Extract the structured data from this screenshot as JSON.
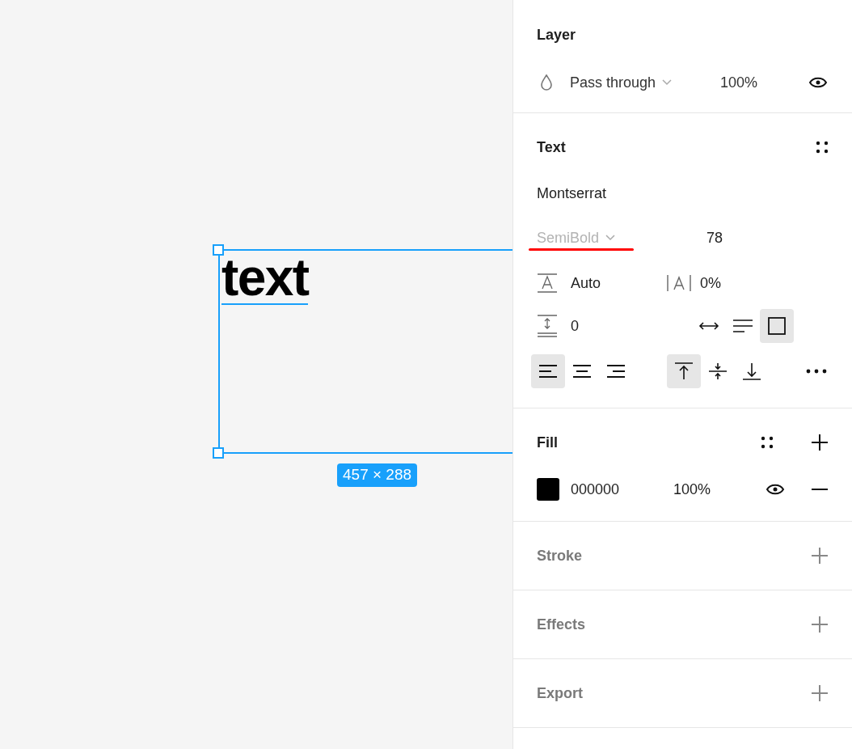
{
  "canvas": {
    "text_layer": "text",
    "size_label": "457 × 288"
  },
  "layer": {
    "title": "Layer",
    "blend_mode": "Pass through",
    "opacity": "100%",
    "visible": true
  },
  "text": {
    "title": "Text",
    "font_family": "Montserrat",
    "font_style": "SemiBold",
    "font_size": "78",
    "line_height": "Auto",
    "letter_spacing": "0%",
    "paragraph_spacing": "0",
    "resize_modes": [
      {
        "kind": "auto-width",
        "selected": false
      },
      {
        "kind": "auto-height",
        "selected": false
      },
      {
        "kind": "fixed",
        "selected": true
      }
    ],
    "align_horizontal": [
      {
        "kind": "left",
        "selected": true
      },
      {
        "kind": "center",
        "selected": false
      },
      {
        "kind": "right",
        "selected": false
      }
    ],
    "align_vertical": [
      {
        "kind": "top",
        "selected": true
      },
      {
        "kind": "middle",
        "selected": false
      },
      {
        "kind": "bottom",
        "selected": false
      }
    ]
  },
  "fill": {
    "title": "Fill",
    "items": [
      {
        "hex": "000000",
        "color": "#000000",
        "opacity": "100%",
        "visible": true
      }
    ]
  },
  "sections": [
    {
      "title": "Stroke"
    },
    {
      "title": "Effects"
    },
    {
      "title": "Export"
    }
  ]
}
